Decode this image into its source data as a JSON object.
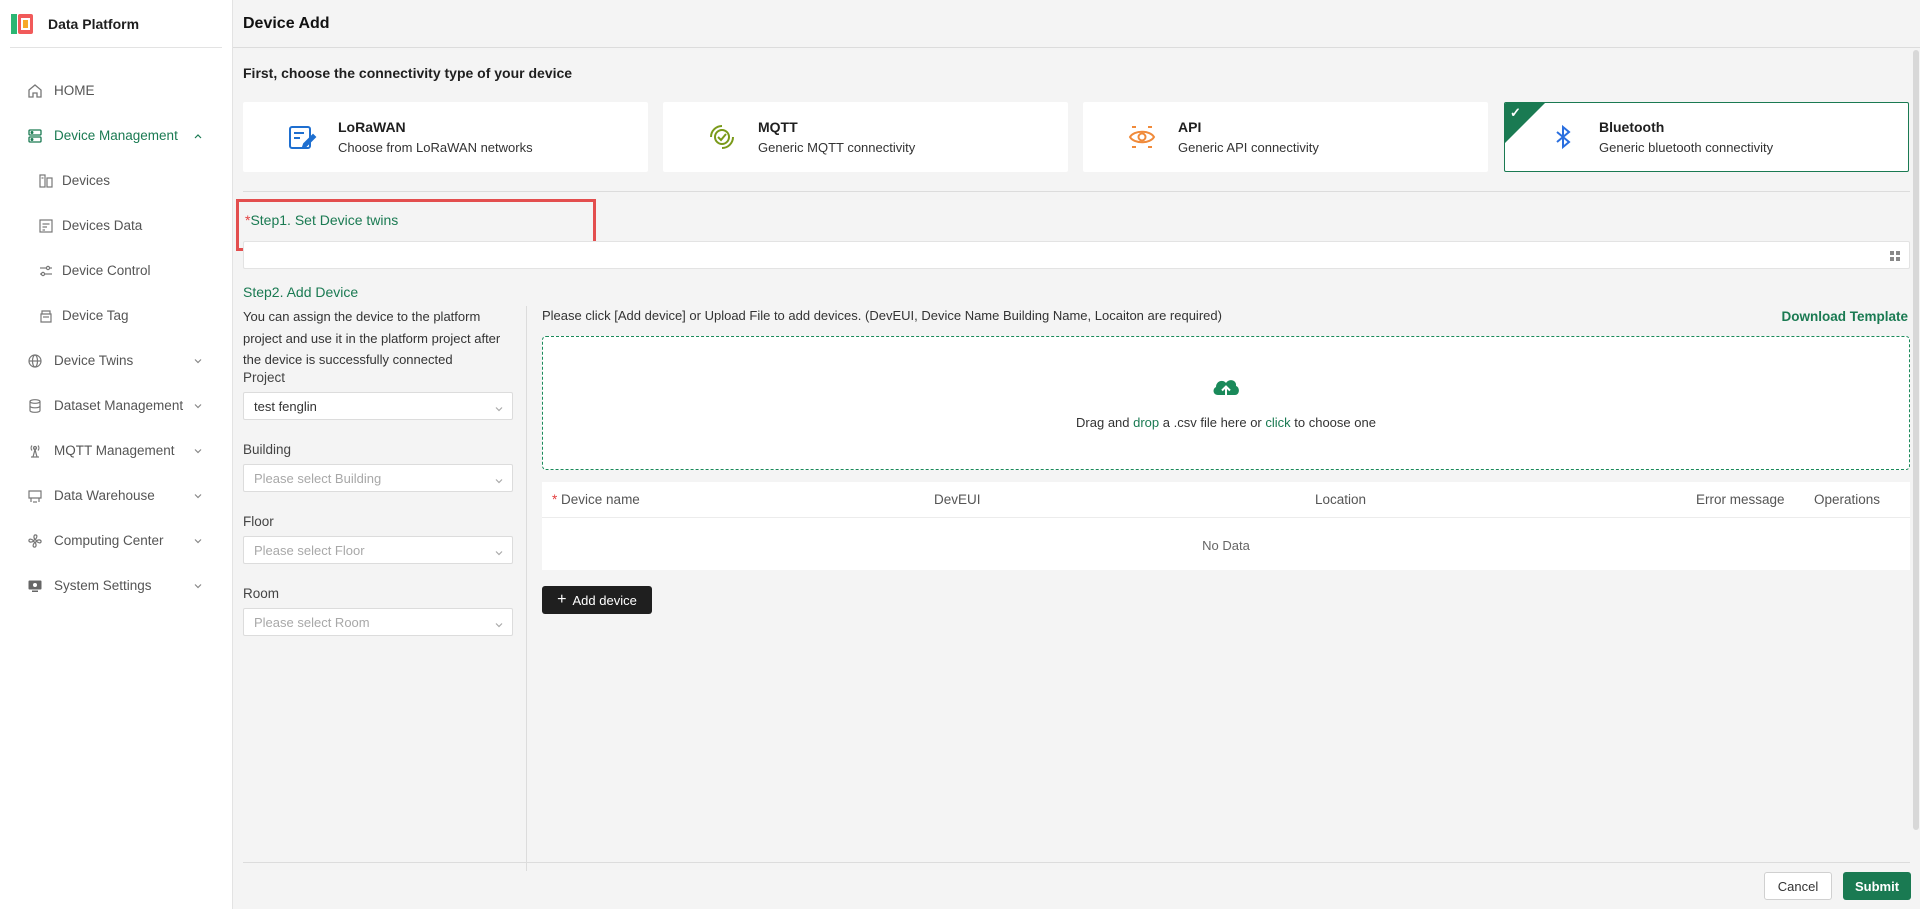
{
  "brand": {
    "title": "Data Platform",
    "logo_icon": "data-platform-logo"
  },
  "sidebar": {
    "items": [
      {
        "label": "HOME",
        "icon": "home-icon"
      },
      {
        "label": "Device Management",
        "icon": "server-icon",
        "expanded": true,
        "active": true,
        "children": [
          {
            "label": "Devices",
            "icon": "devices-icon"
          },
          {
            "label": "Devices Data",
            "icon": "devices-data-icon"
          },
          {
            "label": "Device Control",
            "icon": "sliders-icon"
          },
          {
            "label": "Device Tag",
            "icon": "tag-icon"
          }
        ]
      },
      {
        "label": "Device Twins",
        "icon": "globe-icon"
      },
      {
        "label": "Dataset Management",
        "icon": "database-icon"
      },
      {
        "label": "MQTT Management",
        "icon": "broadcast-icon"
      },
      {
        "label": "Data Warehouse",
        "icon": "warehouse-icon"
      },
      {
        "label": "Computing Center",
        "icon": "fan-icon"
      },
      {
        "label": "System Settings",
        "icon": "monitor-icon"
      }
    ]
  },
  "header": {
    "title": "Device Add"
  },
  "connectivity": {
    "heading": "First, choose the connectivity type of your device",
    "selected": "Bluetooth",
    "options": [
      {
        "title": "LoRaWAN",
        "subtitle": "Choose from LoRaWAN networks",
        "icon": "lorawan-icon"
      },
      {
        "title": "MQTT",
        "subtitle": "Generic MQTT connectivity",
        "icon": "mqtt-icon"
      },
      {
        "title": "API",
        "subtitle": "Generic API connectivity",
        "icon": "api-eye-icon"
      },
      {
        "title": "Bluetooth",
        "subtitle": "Generic bluetooth connectivity",
        "icon": "bluetooth-icon"
      }
    ]
  },
  "step1": {
    "required_mark": "*",
    "label": "Step1. Set Device twins",
    "value": ""
  },
  "step2": {
    "label": "Step2. Add Device",
    "assign_text": "You can assign the device to the platform project and use it in the platform project after the device is successfully connected",
    "fields": [
      {
        "label": "Project",
        "value": "test fenglin",
        "placeholder": ""
      },
      {
        "label": "Building",
        "value": "",
        "placeholder": "Please select Building"
      },
      {
        "label": "Floor",
        "value": "",
        "placeholder": "Please select Floor"
      },
      {
        "label": "Room",
        "value": "",
        "placeholder": "Please select Room"
      }
    ],
    "instruction": "Please click [Add device] or Upload File to add devices. (DevEUI, Device Name Building Name, Locaiton are required)",
    "download_template": "Download Template",
    "dropzone": {
      "text_pre": "Drag and ",
      "drop": "drop",
      "text_mid": " a .csv file here or ",
      "click": "click",
      "text_post": " to choose one"
    },
    "table": {
      "columns": [
        "Device name",
        "DevEUI",
        "Location",
        "Error message",
        "Operations"
      ],
      "required_mark": "*",
      "empty_text": "No Data",
      "rows": []
    },
    "add_button": "Add device"
  },
  "footer": {
    "cancel": "Cancel",
    "submit": "Submit"
  },
  "colors": {
    "accent": "#1a7a52",
    "highlight": "#e34e4e",
    "required": "#e34040"
  }
}
